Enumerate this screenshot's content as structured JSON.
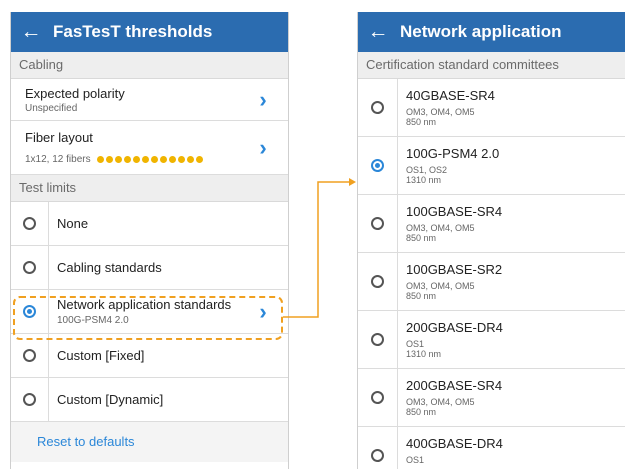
{
  "left": {
    "title": "FasTesT thresholds",
    "cabling_header": "Cabling",
    "polarity": {
      "label": "Expected polarity",
      "value": "Unspecified"
    },
    "fiber": {
      "label": "Fiber layout",
      "value": "1x12, 12 fibers",
      "dot_count": 12,
      "dot_color": "#f0b400"
    },
    "limits_header": "Test limits",
    "options": [
      {
        "label": "None",
        "sub": "",
        "selected": false
      },
      {
        "label": "Cabling standards",
        "sub": "",
        "selected": false
      },
      {
        "label": "Network application standards",
        "sub": "100G-PSM4 2.0",
        "selected": true
      },
      {
        "label": "Custom [Fixed]",
        "sub": "",
        "selected": false
      },
      {
        "label": "Custom [Dynamic]",
        "sub": "",
        "selected": false
      }
    ],
    "reset": "Reset to defaults"
  },
  "right": {
    "title": "Network application",
    "header": "Certification standard committees",
    "items": [
      {
        "name": "40GBASE-SR4",
        "l1": "OM3, OM4, OM5",
        "l2": "850 nm",
        "selected": false
      },
      {
        "name": "100G-PSM4 2.0",
        "l1": "OS1, OS2",
        "l2": "1310 nm",
        "selected": true
      },
      {
        "name": "100GBASE-SR4",
        "l1": "OM3, OM4, OM5",
        "l2": "850 nm",
        "selected": false
      },
      {
        "name": "100GBASE-SR2",
        "l1": "OM3, OM4, OM5",
        "l2": "850 nm",
        "selected": false
      },
      {
        "name": "200GBASE-DR4",
        "l1": "OS1",
        "l2": "1310 nm",
        "selected": false
      },
      {
        "name": "200GBASE-SR4",
        "l1": "OM3, OM4, OM5",
        "l2": "850 nm",
        "selected": false
      },
      {
        "name": "400GBASE-DR4",
        "l1": "OS1",
        "l2": "",
        "selected": false
      }
    ]
  },
  "colors": {
    "appbar": "#2b6cb0",
    "accent": "#2b87d8",
    "highlight": "#f0a020"
  },
  "icons": {
    "back": "back-arrow-icon",
    "chevron": "chevron-right-icon",
    "radio": "radio-icon"
  }
}
